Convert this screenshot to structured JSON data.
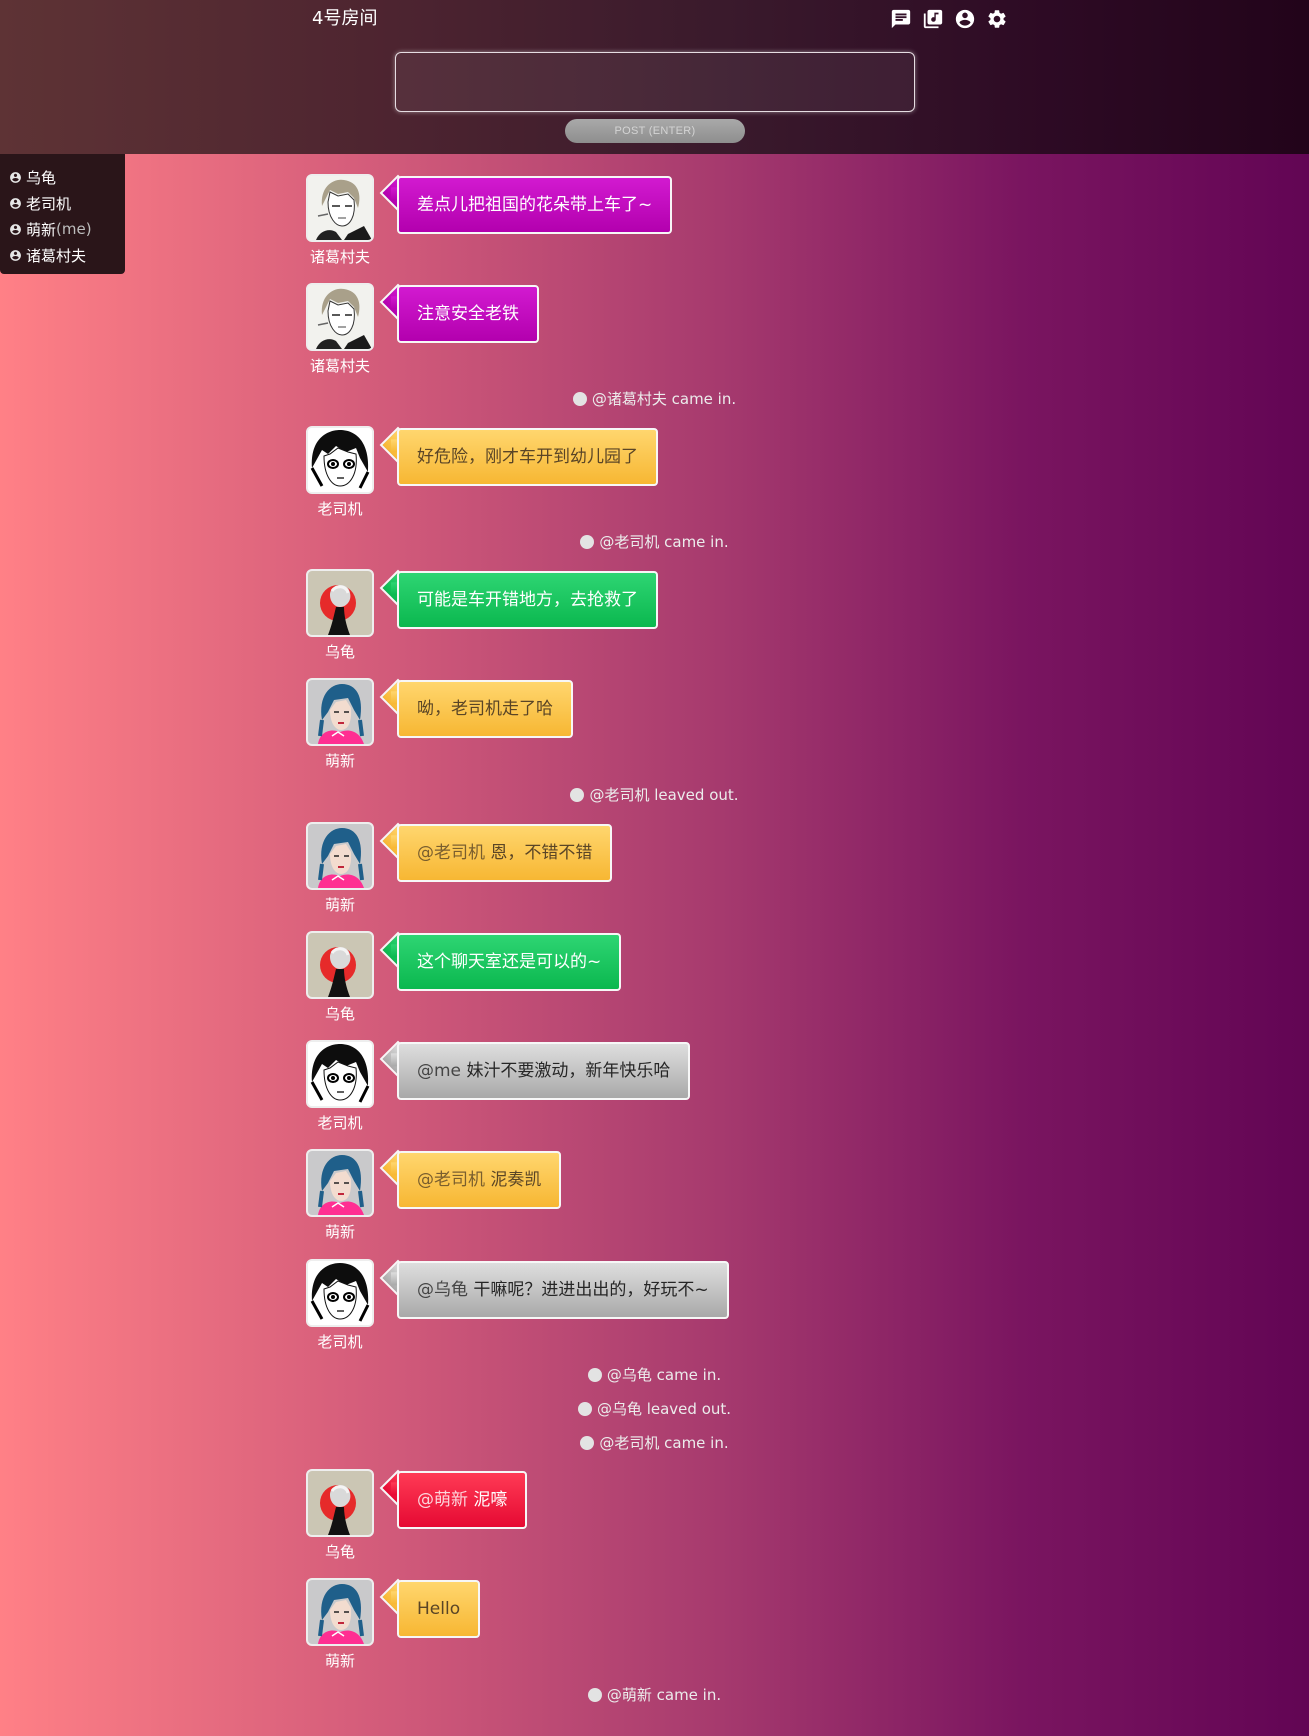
{
  "header": {
    "room_title": "4号房间",
    "icons": [
      "chat-icon",
      "library-music-icon",
      "account-circle-icon",
      "settings-gear-icon"
    ],
    "post_input_value": "",
    "post_button_label": "POST (ENTER)"
  },
  "users": [
    {
      "name": "乌龟",
      "suffix": ""
    },
    {
      "name": "老司机",
      "suffix": ""
    },
    {
      "name": "萌新",
      "suffix": "(me)"
    },
    {
      "name": "诸葛村夫",
      "suffix": ""
    }
  ],
  "feed": [
    {
      "kind": "msg",
      "sender": "诸葛村夫",
      "avatar": "zhuge",
      "color": "magenta",
      "mention": "",
      "text": "差点儿把祖国的花朵带上车了~"
    },
    {
      "kind": "msg",
      "sender": "诸葛村夫",
      "avatar": "zhuge",
      "color": "magenta",
      "mention": "",
      "text": "注意安全老铁"
    },
    {
      "kind": "notice",
      "text": "@诸葛村夫 came in."
    },
    {
      "kind": "msg",
      "sender": "老司机",
      "avatar": "laosiji",
      "color": "yellow",
      "mention": "",
      "text": "好危险，刚才车开到幼儿园了"
    },
    {
      "kind": "notice",
      "text": "@老司机 came in."
    },
    {
      "kind": "msg",
      "sender": "乌龟",
      "avatar": "wugui",
      "color": "green",
      "mention": "",
      "text": "可能是车开错地方，去抢救了"
    },
    {
      "kind": "msg",
      "sender": "萌新",
      "avatar": "mengxin",
      "color": "yellow",
      "mention": "",
      "text": "呦，老司机走了哈"
    },
    {
      "kind": "notice",
      "text": "@老司机 leaved out."
    },
    {
      "kind": "msg",
      "sender": "萌新",
      "avatar": "mengxin",
      "color": "yellow",
      "mention": "@老司机",
      "text": "恩，不错不错"
    },
    {
      "kind": "msg",
      "sender": "乌龟",
      "avatar": "wugui",
      "color": "green",
      "mention": "",
      "text": "这个聊天室还是可以的~"
    },
    {
      "kind": "msg",
      "sender": "老司机",
      "avatar": "laosiji",
      "color": "gray",
      "mention": "@me",
      "text": "妹汁不要激动，新年快乐哈"
    },
    {
      "kind": "msg",
      "sender": "萌新",
      "avatar": "mengxin",
      "color": "yellow",
      "mention": "@老司机",
      "text": "泥奏凯"
    },
    {
      "kind": "msg",
      "sender": "老司机",
      "avatar": "laosiji",
      "color": "gray",
      "mention": "@乌龟",
      "text": "干嘛呢？进进出出的，好玩不~"
    },
    {
      "kind": "notice",
      "text": "@乌龟 came in."
    },
    {
      "kind": "notice",
      "text": "@乌龟 leaved out."
    },
    {
      "kind": "notice",
      "text": "@老司机 came in."
    },
    {
      "kind": "msg",
      "sender": "乌龟",
      "avatar": "wugui",
      "color": "red",
      "mention": "@萌新",
      "text": "泥嚎"
    },
    {
      "kind": "msg",
      "sender": "萌新",
      "avatar": "mengxin",
      "color": "yellow",
      "mention": "",
      "text": "Hello"
    },
    {
      "kind": "notice",
      "text": "@萌新 came in."
    }
  ]
}
